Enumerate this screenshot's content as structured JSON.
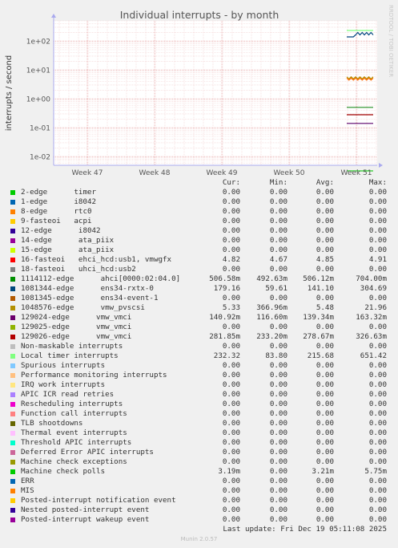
{
  "chart_data": {
    "type": "line",
    "title": "Individual interrupts - by month",
    "ylabel": "interrupts / second",
    "yscale": "log",
    "ylim": [
      0.005,
      500
    ],
    "yticks": [
      "1e+02",
      "1e+01",
      "1e+00",
      "1e-01",
      "1e-02"
    ],
    "xticks": [
      "Week 47",
      "Week 48",
      "Week 49",
      "Week 50",
      "Week 51"
    ],
    "watermark": "RRDTOOL / TOBI OETIKER",
    "series": [
      {
        "name": "Local timer interrupts",
        "color": "#7fff7f",
        "values": [
          232.32
        ]
      },
      {
        "name": "1081344-edge ens34-rxtx-0",
        "color": "#00467f",
        "values": [
          179.16
        ]
      },
      {
        "name": "1048576-edge vmw_pvscsi",
        "color": "#b38f00",
        "values": [
          5.33
        ]
      },
      {
        "name": "16-fasteoi ehci_hcd:usb1, vmwgfx",
        "color": "#fc6900",
        "values": [
          4.82
        ]
      },
      {
        "name": "1114112-edge ahci[0000:02:04.0]",
        "color": "#238e23",
        "values": [
          0.50658
        ]
      },
      {
        "name": "129026-edge vmw_vmci",
        "color": "#a00000",
        "values": [
          0.28185
        ]
      },
      {
        "name": "129024-edge vmw_vmci",
        "color": "#5a006b",
        "values": [
          0.14092
        ]
      },
      {
        "name": "Machine check polls",
        "color": "#29d029",
        "values": [
          0.00319
        ]
      }
    ]
  },
  "legend": {
    "headers": {
      "cur": "Cur:",
      "min": "Min:",
      "avg": "Avg:",
      "max": "Max:"
    },
    "rows": [
      {
        "name": "2-edge      timer",
        "color": "#00cc00",
        "cur": "0.00",
        "min": "0.00",
        "avg": "0.00",
        "max": "0.00"
      },
      {
        "name": "1-edge      i8042",
        "color": "#0066b3",
        "cur": "0.00",
        "min": "0.00",
        "avg": "0.00",
        "max": "0.00"
      },
      {
        "name": "8-edge      rtc0",
        "color": "#ff8000",
        "cur": "0.00",
        "min": "0.00",
        "avg": "0.00",
        "max": "0.00"
      },
      {
        "name": "9-fasteoi   acpi",
        "color": "#ffcc00",
        "cur": "0.00",
        "min": "0.00",
        "avg": "0.00",
        "max": "0.00"
      },
      {
        "name": "12-edge      i8042",
        "color": "#330099",
        "cur": "0.00",
        "min": "0.00",
        "avg": "0.00",
        "max": "0.00"
      },
      {
        "name": "14-edge      ata_piix",
        "color": "#990099",
        "cur": "0.00",
        "min": "0.00",
        "avg": "0.00",
        "max": "0.00"
      },
      {
        "name": "15-edge      ata_piix",
        "color": "#ccff00",
        "cur": "0.00",
        "min": "0.00",
        "avg": "0.00",
        "max": "0.00"
      },
      {
        "name": "16-fasteoi   ehci_hcd:usb1, vmwgfx",
        "color": "#ff0000",
        "cur": "4.82",
        "min": "4.67",
        "avg": "4.85",
        "max": "4.91"
      },
      {
        "name": "18-fasteoi   uhci_hcd:usb2",
        "color": "#808080",
        "cur": "0.00",
        "min": "0.00",
        "avg": "0.00",
        "max": "0.00"
      },
      {
        "name": "1114112-edge      ahci[0000:02:04.0]",
        "color": "#008f00",
        "cur": "506.58m",
        "min": "492.63m",
        "avg": "506.12m",
        "max": "704.00m"
      },
      {
        "name": "1081344-edge      ens34-rxtx-0",
        "color": "#00487d",
        "cur": "179.16",
        "min": "59.61",
        "avg": "141.10",
        "max": "304.69"
      },
      {
        "name": "1081345-edge      ens34-event-1",
        "color": "#b35a00",
        "cur": "0.00",
        "min": "0.00",
        "avg": "0.00",
        "max": "0.00"
      },
      {
        "name": "1048576-edge      vmw_pvscsi",
        "color": "#b38f00",
        "cur": "5.33",
        "min": "366.96m",
        "avg": "5.48",
        "max": "21.96"
      },
      {
        "name": "129024-edge      vmw_vmci",
        "color": "#6b006b",
        "cur": "140.92m",
        "min": "116.60m",
        "avg": "139.34m",
        "max": "163.32m"
      },
      {
        "name": "129025-edge      vmw_vmci",
        "color": "#8fb300",
        "cur": "0.00",
        "min": "0.00",
        "avg": "0.00",
        "max": "0.00"
      },
      {
        "name": "129026-edge      vmw_vmci",
        "color": "#b30000",
        "cur": "281.85m",
        "min": "233.20m",
        "avg": "278.67m",
        "max": "326.63m"
      },
      {
        "name": "Non-maskable interrupts",
        "color": "#bebebe",
        "cur": "0.00",
        "min": "0.00",
        "avg": "0.00",
        "max": "0.00"
      },
      {
        "name": "Local timer interrupts",
        "color": "#80ff80",
        "cur": "232.32",
        "min": "83.80",
        "avg": "215.68",
        "max": "651.42"
      },
      {
        "name": "Spurious interrupts",
        "color": "#80c9ff",
        "cur": "0.00",
        "min": "0.00",
        "avg": "0.00",
        "max": "0.00"
      },
      {
        "name": "Performance monitoring interrupts",
        "color": "#ffc080",
        "cur": "0.00",
        "min": "0.00",
        "avg": "0.00",
        "max": "0.00"
      },
      {
        "name": "IRQ work interrupts",
        "color": "#ffe680",
        "cur": "0.00",
        "min": "0.00",
        "avg": "0.00",
        "max": "0.00"
      },
      {
        "name": "APIC ICR read retries",
        "color": "#aa80ff",
        "cur": "0.00",
        "min": "0.00",
        "avg": "0.00",
        "max": "0.00"
      },
      {
        "name": "Rescheduling interrupts",
        "color": "#ee00cc",
        "cur": "0.00",
        "min": "0.00",
        "avg": "0.00",
        "max": "0.00"
      },
      {
        "name": "Function call interrupts",
        "color": "#ff8080",
        "cur": "0.00",
        "min": "0.00",
        "avg": "0.00",
        "max": "0.00"
      },
      {
        "name": "TLB shootdowns",
        "color": "#666600",
        "cur": "0.00",
        "min": "0.00",
        "avg": "0.00",
        "max": "0.00"
      },
      {
        "name": "Thermal event interrupts",
        "color": "#ffbfff",
        "cur": "0.00",
        "min": "0.00",
        "avg": "0.00",
        "max": "0.00"
      },
      {
        "name": "Threshold APIC interrupts",
        "color": "#00ffcc",
        "cur": "0.00",
        "min": "0.00",
        "avg": "0.00",
        "max": "0.00"
      },
      {
        "name": "Deferred Error APIC interrupts",
        "color": "#cc6699",
        "cur": "0.00",
        "min": "0.00",
        "avg": "0.00",
        "max": "0.00"
      },
      {
        "name": "Machine check exceptions",
        "color": "#999900",
        "cur": "0.00",
        "min": "0.00",
        "avg": "0.00",
        "max": "0.00"
      },
      {
        "name": "Machine check polls",
        "color": "#00cc00",
        "cur": "3.19m",
        "min": "0.00",
        "avg": "3.21m",
        "max": "5.75m"
      },
      {
        "name": "ERR",
        "color": "#0066b3",
        "cur": "0.00",
        "min": "0.00",
        "avg": "0.00",
        "max": "0.00"
      },
      {
        "name": "MIS",
        "color": "#ff8000",
        "cur": "0.00",
        "min": "0.00",
        "avg": "0.00",
        "max": "0.00"
      },
      {
        "name": "Posted-interrupt notification event",
        "color": "#ffcc00",
        "cur": "0.00",
        "min": "0.00",
        "avg": "0.00",
        "max": "0.00"
      },
      {
        "name": "Nested posted-interrupt event",
        "color": "#330099",
        "cur": "0.00",
        "min": "0.00",
        "avg": "0.00",
        "max": "0.00"
      },
      {
        "name": "Posted-interrupt wakeup event",
        "color": "#990099",
        "cur": "0.00",
        "min": "0.00",
        "avg": "0.00",
        "max": "0.00"
      }
    ]
  },
  "footer": {
    "last_update": "Last update: Fri Dec 19 05:11:08 2025",
    "version": "Munin 2.0.57"
  }
}
